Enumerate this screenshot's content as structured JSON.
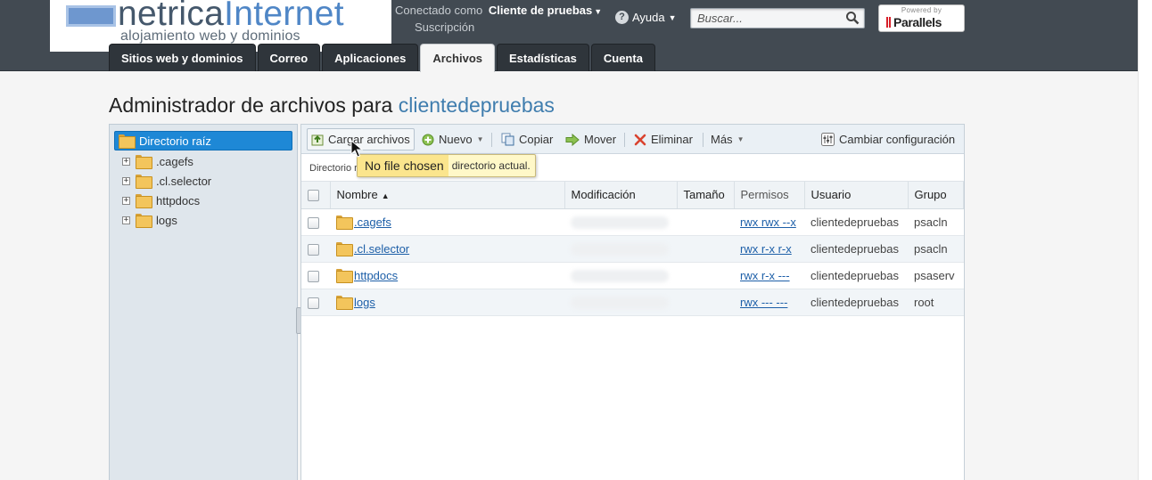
{
  "header": {
    "logo_name_main": "netrica",
    "logo_name_accent": "Internet",
    "logo_tagline": "alojamiento web y dominios",
    "connected_as_label": "Conectado como",
    "user_name": "Cliente de pruebas",
    "subscription_label": "Suscripción",
    "help_label": "Ayuda",
    "search_placeholder": "Buscar...",
    "powered_by": "Powered by",
    "parallels_brand": "Parallels",
    "parallels_accent": "#d8202a"
  },
  "tabs": [
    {
      "label": "Sitios web y dominios",
      "active": false
    },
    {
      "label": "Correo",
      "active": false
    },
    {
      "label": "Aplicaciones",
      "active": false
    },
    {
      "label": "Archivos",
      "active": true
    },
    {
      "label": "Estadísticas",
      "active": false
    },
    {
      "label": "Cuenta",
      "active": false
    }
  ],
  "page": {
    "title_prefix": "Administrador de archivos para",
    "title_domain": "clientedepruebas"
  },
  "tree": {
    "root": "Directorio raíz",
    "items": [
      ".cagefs",
      ".cl.selector",
      "httpdocs",
      "logs"
    ],
    "expander_glyph": "+"
  },
  "toolbar": {
    "upload": "Cargar archivos",
    "new": "Nuevo",
    "copy": "Copiar",
    "move": "Mover",
    "delete": "Eliminar",
    "more": "Más",
    "settings": "Cambiar configuración"
  },
  "path_label": "Directorio r",
  "tooltip": {
    "chip": "No file chosen",
    "text": "directorio actual."
  },
  "table": {
    "columns": {
      "name": "Nombre",
      "modified": "Modificación",
      "size": "Tamaño",
      "perms": "Permisos",
      "user": "Usuario",
      "group": "Grupo"
    },
    "rows": [
      {
        "name": ".cagefs",
        "perms": "rwx rwx --x",
        "user": "clientedepruebas",
        "group": "psacln"
      },
      {
        "name": ".cl.selector",
        "perms": "rwx r-x r-x",
        "user": "clientedepruebas",
        "group": "psacln"
      },
      {
        "name": "httpdocs",
        "perms": "rwx r-x ---",
        "user": "clientedepruebas",
        "group": "psaserv"
      },
      {
        "name": "logs",
        "perms": "rwx --- ---",
        "user": "clientedepruebas",
        "group": "root"
      }
    ]
  }
}
